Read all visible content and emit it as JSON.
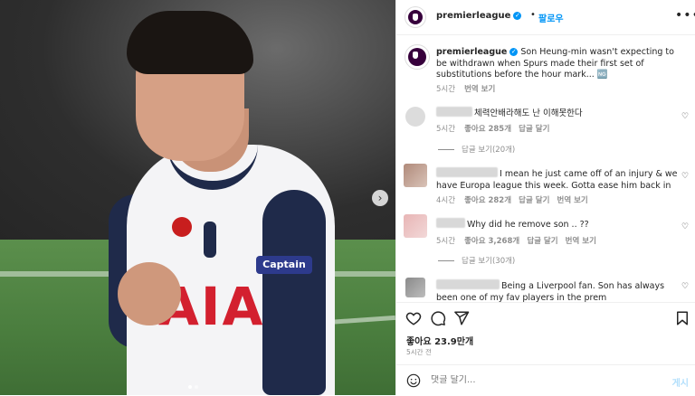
{
  "post": {
    "account": "premierleague",
    "follow_label": "팔로우",
    "separator": "•",
    "more_label": "•••",
    "next_label": "›"
  },
  "photo": {
    "sponsor_text": "AIA",
    "armband_text": "Captain"
  },
  "caption": {
    "username": "premierleague",
    "text": "Son Heung-min wasn't expecting to be withdrawn when Spurs made their first set of substitutions before the hour mark... 🆖",
    "time": "5시간",
    "translate": "번역 보기"
  },
  "comments": [
    {
      "text": "체력안배라해도 난 이해못한다",
      "time": "5시간",
      "likes": "좋아요 285개",
      "reply": "답글 달기",
      "view_replies": "답글 보기(20개)"
    },
    {
      "text": "I mean he just came off of an injury & we have Europa league this week. Gotta ease him back in",
      "time": "4시간",
      "likes": "좋아요 282개",
      "reply": "답글 달기",
      "translate": "번역 보기"
    },
    {
      "text": "Why did he remove son .. ??",
      "time": "5시간",
      "likes": "좋아요 3,268개",
      "reply": "답글 달기",
      "translate": "번역 보기",
      "view_replies": "답글 보기(30개)"
    },
    {
      "text": "Being a Liverpool fan. Son has always been one of my fav players in the prem"
    }
  ],
  "actions": {
    "likes": "좋아요 23.9만개",
    "ago": "5시간 전"
  },
  "composer": {
    "placeholder": "댓글 달기...",
    "post_label": "게시"
  },
  "icons": [
    "heart-icon",
    "comment-icon",
    "share-icon",
    "bookmark-icon",
    "emoji-icon",
    "verified-icon",
    "more-icon",
    "next-arrow-icon"
  ],
  "colors": {
    "link": "#0095f6",
    "muted": "#8e8e8e",
    "text": "#262626",
    "post_disabled": "#b2dffc"
  }
}
